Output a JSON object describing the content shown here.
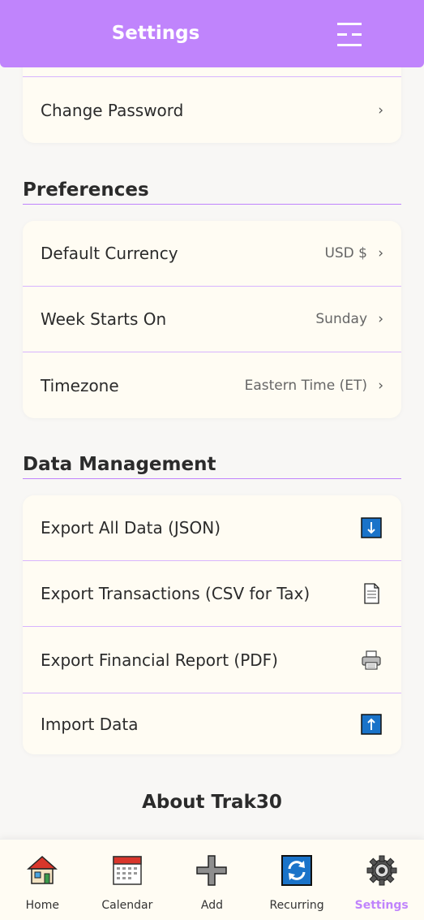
{
  "header": {
    "title": "Settings",
    "menu_icon": "menu-icon"
  },
  "account": {
    "change_password_label": "Change Password",
    "chevron": "›"
  },
  "preferences": {
    "title": "Preferences",
    "items": [
      {
        "label": "Default Currency",
        "value": "USD $",
        "chevron": "›"
      },
      {
        "label": "Week Starts On",
        "value": "Sunday",
        "chevron": "›"
      },
      {
        "label": "Timezone",
        "value": "Eastern Time (ET)",
        "chevron": "›"
      }
    ]
  },
  "data_management": {
    "title": "Data Management",
    "items": [
      {
        "label": "Export All Data (JSON)",
        "icon": "download-arrow-icon"
      },
      {
        "label": "Export Transactions (CSV for Tax)",
        "icon": "document-icon"
      },
      {
        "label": "Export Financial Report (PDF)",
        "icon": "printer-icon"
      },
      {
        "label": "Import Data",
        "icon": "upload-arrow-icon"
      }
    ]
  },
  "about": {
    "title": "About Trak30"
  },
  "nav": {
    "items": [
      {
        "label": "Home",
        "icon": "house-icon"
      },
      {
        "label": "Calendar",
        "icon": "calendar-icon"
      },
      {
        "label": "Add",
        "icon": "plus-icon"
      },
      {
        "label": "Recurring",
        "icon": "repeat-icon"
      },
      {
        "label": "Settings",
        "icon": "gear-icon"
      }
    ],
    "active": "Settings"
  },
  "colors": {
    "accent": "#c084fc",
    "card": "#fffcf3",
    "background": "#f8f7f5",
    "divider": "#d8b4fe"
  }
}
